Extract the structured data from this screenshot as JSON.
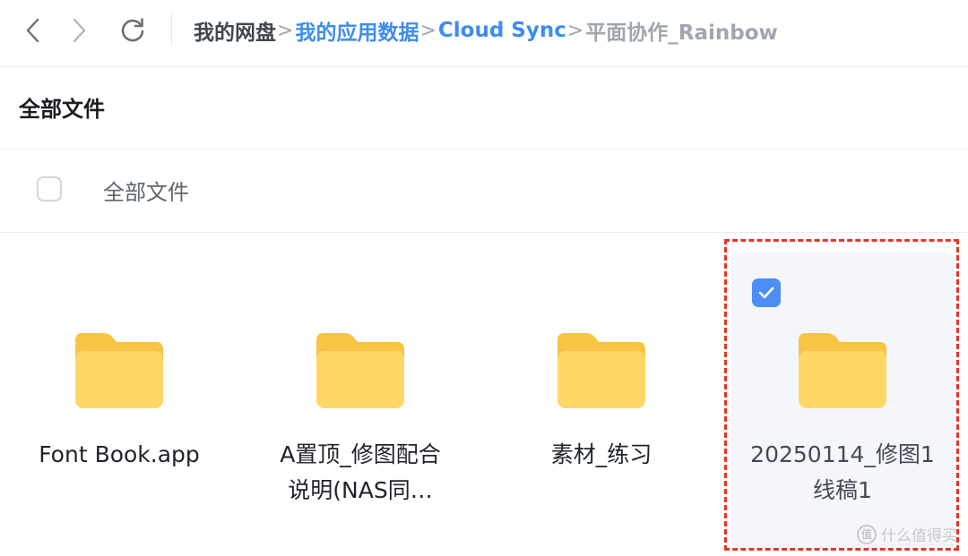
{
  "nav": {
    "back_icon": "chevron-left-icon",
    "forward_icon": "chevron-right-icon",
    "refresh_icon": "refresh-icon"
  },
  "breadcrumb": {
    "separator": ">",
    "items": [
      {
        "label": "我的网盘",
        "state": "root"
      },
      {
        "label": "我的应用数据",
        "state": "link"
      },
      {
        "label": "Cloud Sync",
        "state": "link"
      },
      {
        "label": "平面协作_Rainbow",
        "state": "current"
      }
    ]
  },
  "section": {
    "title": "全部文件"
  },
  "select_all": {
    "label": "全部文件",
    "checked": false
  },
  "files": [
    {
      "name": "Font Book.app",
      "line1": "Font Book.app",
      "line2": "",
      "type": "folder",
      "selected": false
    },
    {
      "name": "A置顶_修图配合说明(NAS同…",
      "line1": "A置顶_修图配合",
      "line2": "说明(NAS同…",
      "type": "folder",
      "selected": false
    },
    {
      "name": "素材_练习",
      "line1": "素材_练习",
      "line2": "",
      "type": "folder",
      "selected": false
    },
    {
      "name": "20250114_修图1线稿1",
      "line1": "20250114_修图1",
      "line2": "线稿1",
      "type": "folder",
      "selected": true
    }
  ],
  "colors": {
    "accent": "#3d8cf0",
    "folder_front": "#ffd766",
    "folder_back": "#f7c444",
    "selected_bg": "#f4f6fb",
    "check_bg": "#4c8ef5",
    "highlight": "#e2362a"
  },
  "watermark": {
    "icon_glyph": "值",
    "text": "什么值得买"
  }
}
